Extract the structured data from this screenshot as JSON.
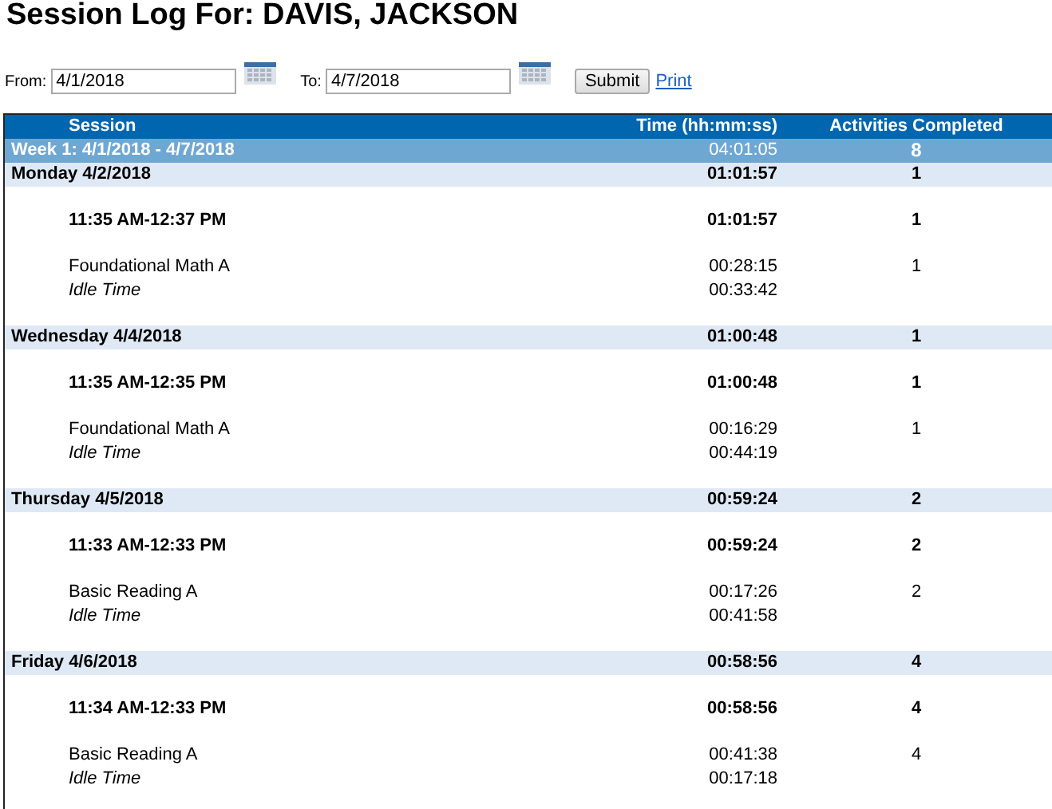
{
  "title": {
    "label": "Session Log For:",
    "name": "DAVIS, JACKSON"
  },
  "filter": {
    "from_label": "From:",
    "from_value": "4/1/2018",
    "to_label": "To:",
    "to_value": "4/7/2018",
    "submit": "Submit",
    "print": "Print"
  },
  "table": {
    "columns": [
      "Session",
      "Time (hh:mm:ss)",
      "Activities Completed"
    ],
    "week": {
      "label": "Week 1: 4/1/2018 - 4/7/2018",
      "time": "04:01:05",
      "activities": "8"
    },
    "days": [
      {
        "label": "Monday 4/2/2018",
        "time": "01:01:57",
        "activities": "1",
        "sessions": [
          {
            "label": "11:35 AM-12:37 PM",
            "time": "01:01:57",
            "activities": "1",
            "items": [
              {
                "kind": "activity",
                "label": "Foundational Math A",
                "time": "00:28:15",
                "activities": "1"
              },
              {
                "kind": "idle",
                "label": "Idle Time",
                "time": "00:33:42"
              }
            ]
          }
        ]
      },
      {
        "label": "Wednesday 4/4/2018",
        "time": "01:00:48",
        "activities": "1",
        "sessions": [
          {
            "label": "11:35 AM-12:35 PM",
            "time": "01:00:48",
            "activities": "1",
            "items": [
              {
                "kind": "activity",
                "label": "Foundational Math A",
                "time": "00:16:29",
                "activities": "1"
              },
              {
                "kind": "idle",
                "label": "Idle Time",
                "time": "00:44:19"
              }
            ]
          }
        ]
      },
      {
        "label": "Thursday 4/5/2018",
        "time": "00:59:24",
        "activities": "2",
        "sessions": [
          {
            "label": "11:33 AM-12:33 PM",
            "time": "00:59:24",
            "activities": "2",
            "items": [
              {
                "kind": "activity",
                "label": "Basic Reading A",
                "time": "00:17:26",
                "activities": "2"
              },
              {
                "kind": "idle",
                "label": "Idle Time",
                "time": "00:41:58"
              }
            ]
          }
        ]
      },
      {
        "label": "Friday 4/6/2018",
        "time": "00:58:56",
        "activities": "4",
        "sessions": [
          {
            "label": "11:34 AM-12:33 PM",
            "time": "00:58:56",
            "activities": "4",
            "items": [
              {
                "kind": "activity",
                "label": "Basic Reading A",
                "time": "00:41:38",
                "activities": "4"
              },
              {
                "kind": "idle",
                "label": "Idle Time",
                "time": "00:17:18"
              }
            ]
          }
        ]
      }
    ]
  }
}
